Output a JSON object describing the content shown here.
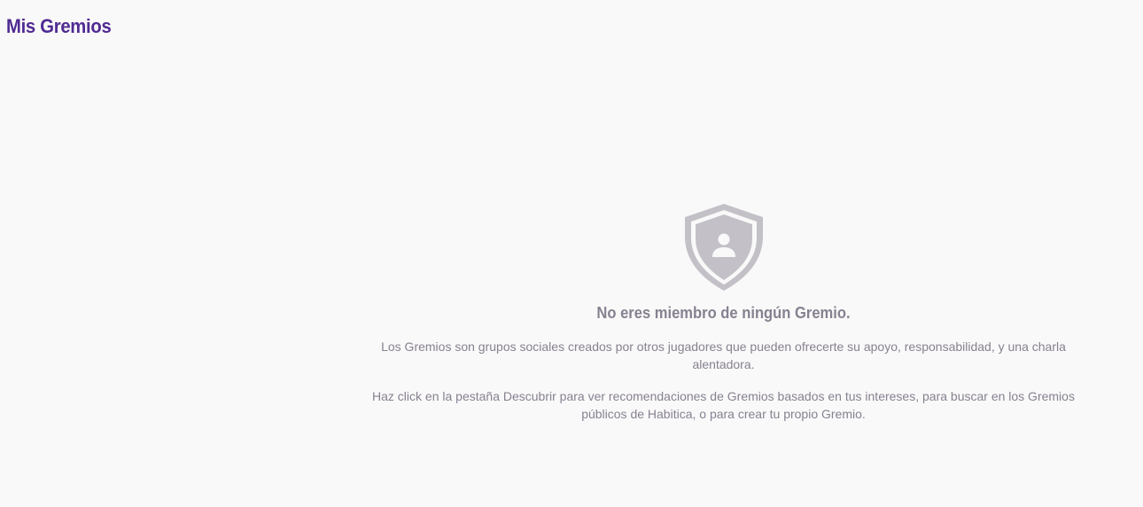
{
  "header": {
    "title": "Mis Gremios"
  },
  "empty_state": {
    "icon": "shield-user-icon",
    "title": "No eres miembro de ningún Gremio.",
    "description": "Los Gremios son grupos sociales creados por otros jugadores que pueden ofrecerte su apoyo, responsabilidad, y una charla alentadora.",
    "hint": "Haz click en la pestaña Descubrir para ver recomendaciones de Gremios basados en tus intereses, para buscar en los Gremios públicos de Habitica, o para crear tu propio Gremio."
  },
  "colors": {
    "title": "#4f2a93",
    "muted_text": "#878190",
    "icon": "#c3c0c7",
    "background": "#f9f9f9"
  }
}
